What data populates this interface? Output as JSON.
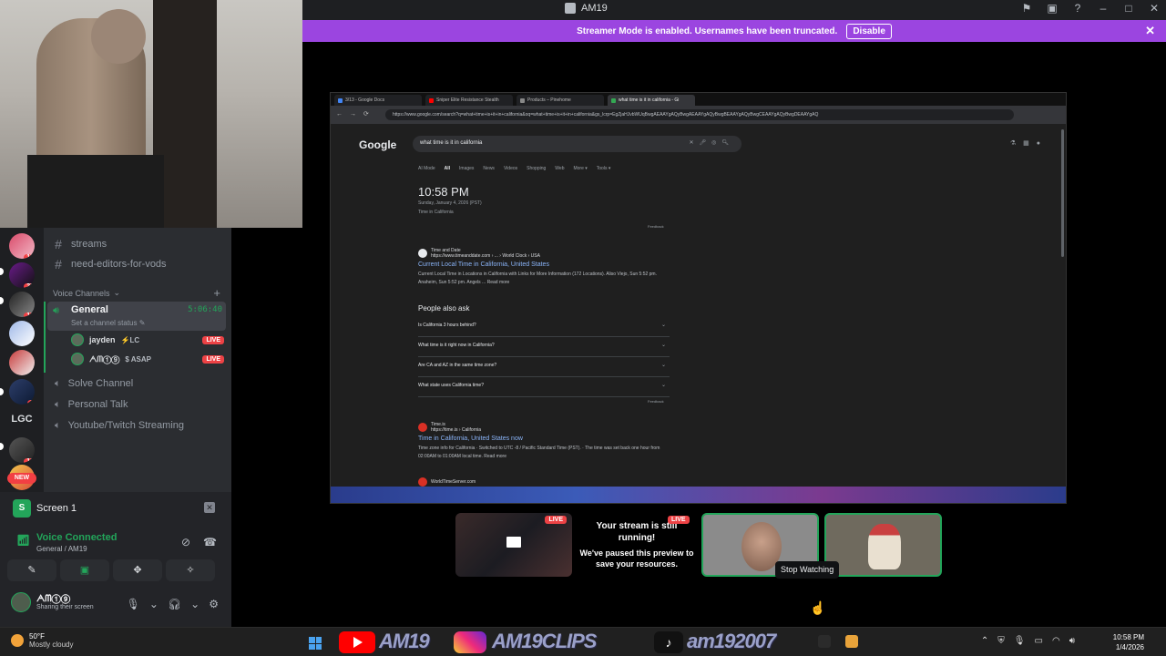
{
  "titlebar": {
    "title": "AM19"
  },
  "banner": {
    "text": "Streamer Mode is enabled. Usernames have been truncated.",
    "button": "Disable"
  },
  "servers": [
    {
      "badge": "15"
    },
    {
      "badge": "25"
    },
    {
      "badge": "18"
    },
    {
      "badge": ""
    },
    {
      "badge": ""
    },
    {
      "badge": "1"
    },
    {
      "label": "LGC"
    },
    {
      "badge": "10"
    },
    {
      "badge": "NEW"
    }
  ],
  "channels": {
    "text": [
      "streams",
      "need-editors-for-vods"
    ],
    "voice_category": "Voice Channels",
    "general": {
      "name": "General",
      "timer": "5:06:40",
      "status": "Set a channel status"
    },
    "users": [
      {
        "name": "jayden",
        "tag": "LC",
        "live": "LIVE"
      },
      {
        "name": "ᗅᗰ①⑨",
        "tag": "ASAP",
        "live": "LIVE"
      }
    ],
    "voice": [
      "Solve Channel",
      "Personal Talk",
      "Youtube/Twitch Streaming"
    ]
  },
  "panel": {
    "screen_title": "Screen 1",
    "voice_status": "Voice Connected",
    "voice_channel": "General / AM19",
    "user_name": "ᗅᗰ①⑨",
    "user_status": "Sharing their screen"
  },
  "browser": {
    "tabs": [
      "3/13 - Google Docs",
      "Sniper Elite Resistance Stealth",
      "Products – Pinehome",
      "what time is it in california - Gi"
    ],
    "url": "https://www.google.com/search?q=what+time+is+it+in+california&oq=what+time+is+it+in+california&gs_lcrp=EgZjaHJvbWUqBwgAEAAYgAQyBwgAEAAYgAQyBwgBEAAYgAQyBwgCEAAYgAQyBwgDEAAYgAQ",
    "logo": "Google",
    "query": "what time is it in california",
    "search_tabs": [
      "AI Mode",
      "All",
      "Images",
      "News",
      "Videos",
      "Shopping",
      "Web",
      "More ▾",
      "Tools ▾"
    ],
    "time": "10:58 PM",
    "date": "Sunday, January 4, 2026 (PST)",
    "tz": "Time in California",
    "feedback": "Feedback",
    "result1": {
      "source": "Time and Date",
      "url": "https://www.timeanddate.com › ... › World Clock › USA",
      "title": "Current Local Time in California, United States",
      "snippet": "Current Local Time in Locations in California with Links for More Information (172 Locations). Aliso Viejo, Sun 5:52 pm. Anaheim, Sun 5:52 pm. Angels ... Read more"
    },
    "paa_title": "People also ask",
    "paa": [
      "Is California 3 hours behind?",
      "What time is it right now in California?",
      "Are CA and AZ in the same time zone?",
      "What state uses California time?"
    ],
    "result2": {
      "source": "Time.is",
      "url": "https://time.is › California",
      "title": "Time in California, United States now",
      "snippet": "Time zone info for California · Switched to UTC -8 / Pacific Standard Time (PST). · The time was set back one hour from 02:00AM to 01:00AM local time. Read more"
    },
    "result3": {
      "source": "WorldTimeServer.com"
    }
  },
  "tiles": {
    "live": "LIVE",
    "msg_title": "Your stream is still running!",
    "msg_body": "We've paused this preview to save your resources.",
    "tooltip": "Stop Watching"
  },
  "taskbar": {
    "temp": "50°F",
    "weather": "Mostly cloudy",
    "overlay1": "AM19",
    "overlay2": "AM19CLIPS",
    "overlay3": "am192007",
    "time": "10:58 PM",
    "date": "1/4/2026"
  },
  "colors": {
    "accent": "#9b45e0",
    "green": "#23a55a",
    "live": "#ed4245"
  }
}
